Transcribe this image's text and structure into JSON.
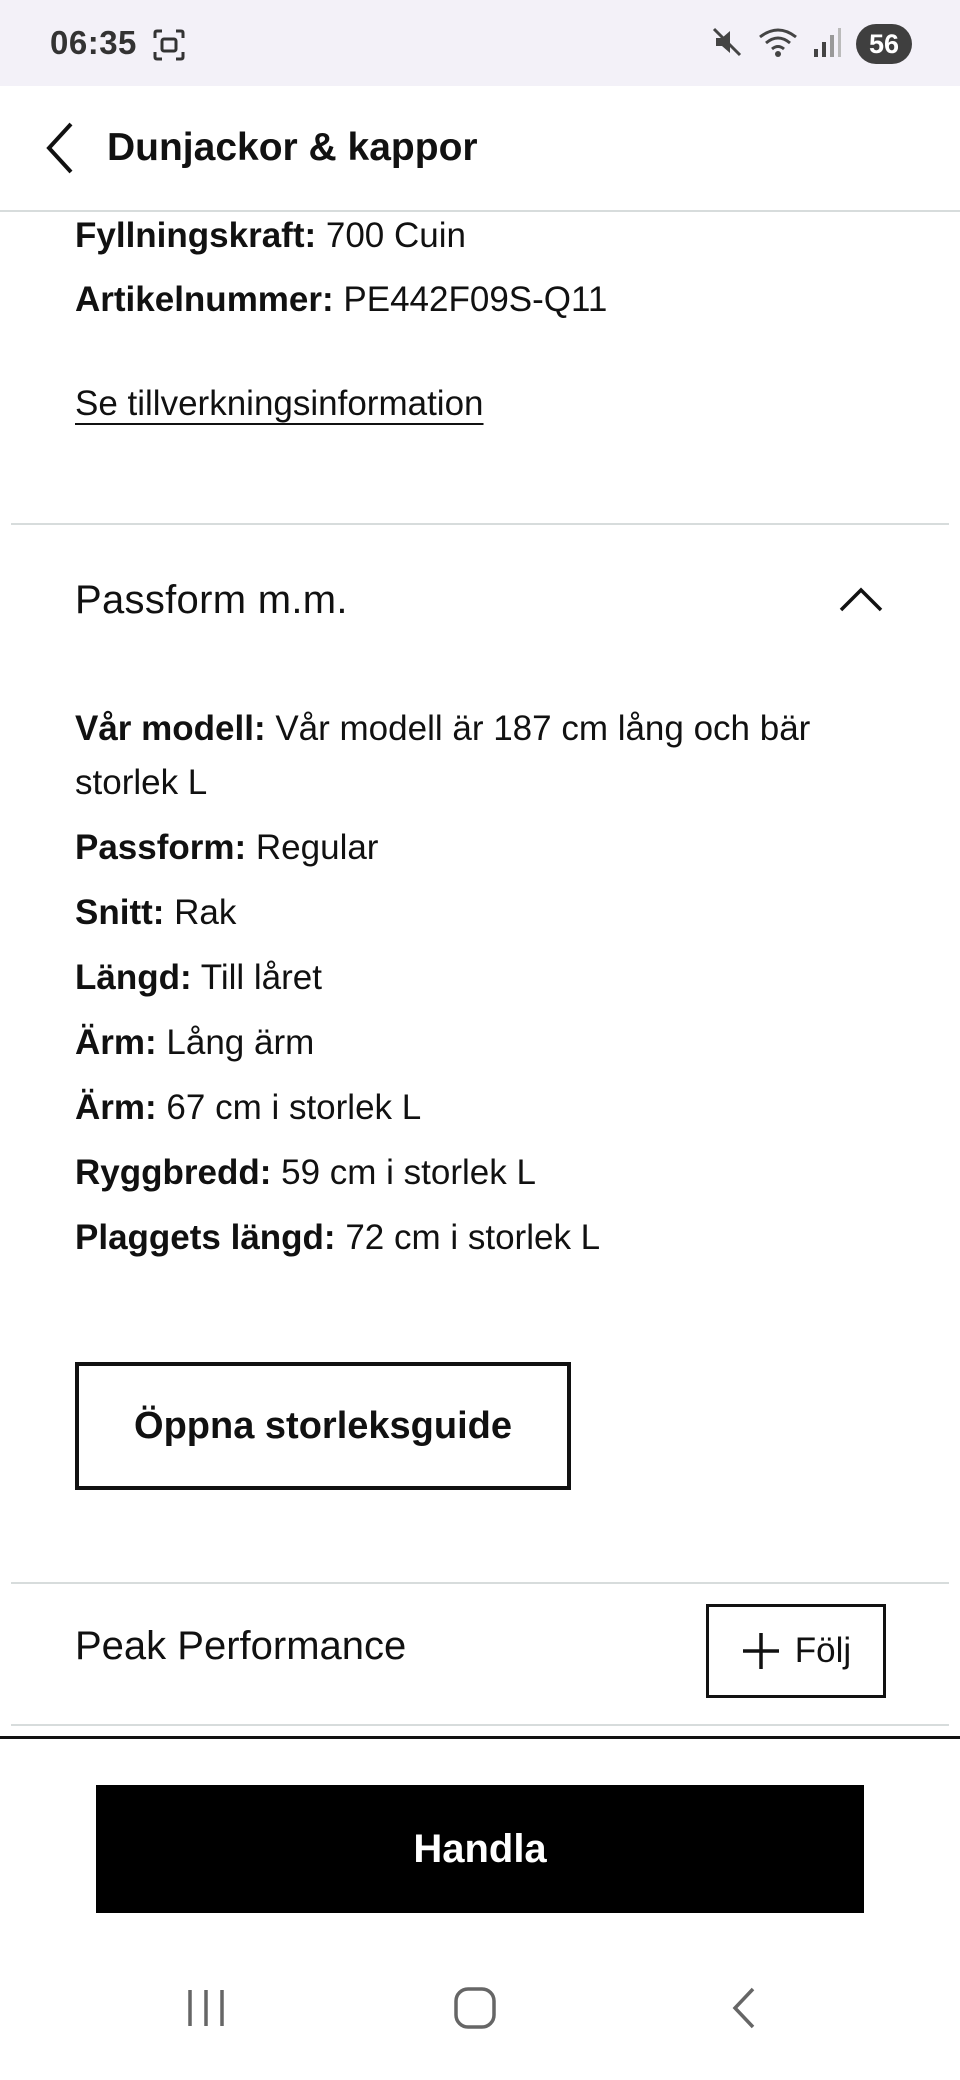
{
  "status_bar": {
    "time": "06:35",
    "battery": "56",
    "icons": [
      "screenshot-icon",
      "mute-icon",
      "wifi-icon",
      "signal-icon"
    ]
  },
  "header": {
    "title": "Dunjackor & kappor",
    "back_icon": "chevron-left-icon"
  },
  "details": {
    "fill_power_label": "Fyllningskraft:",
    "fill_power_value": " 700 Cuin",
    "article_number_label": "Artikelnummer:",
    "article_number_value": " PE442F09S-Q11",
    "manufacturing_link": "Se tillverkningsinformation"
  },
  "fit_section": {
    "title": "Passform m.m.",
    "expanded_icon": "chevron-up-icon",
    "rows": [
      {
        "label": "Vår modell:",
        "value": " Vår modell är 187 cm lång och bär storlek L"
      },
      {
        "label": "Passform:",
        "value": " Regular"
      },
      {
        "label": "Snitt:",
        "value": " Rak"
      },
      {
        "label": "Längd:",
        "value": " Till låret"
      },
      {
        "label": "Ärm:",
        "value": " Lång ärm"
      },
      {
        "label": "Ärm:",
        "value": " 67 cm i storlek L"
      },
      {
        "label": "Ryggbredd:",
        "value": " 59 cm i storlek L"
      },
      {
        "label": "Plaggets längd:",
        "value": " 72 cm i storlek L"
      }
    ],
    "size_guide_button": "Öppna storleksguide"
  },
  "brand": {
    "name": "Peak Performance",
    "follow_label": "Följ",
    "follow_icon": "plus-icon"
  },
  "cta": {
    "buy_label": "Handla"
  },
  "nav": {
    "recents_icon": "recents-icon",
    "home_icon": "home-icon",
    "back_icon": "back-icon"
  },
  "colors": {
    "status_bar_bg": "#f3f1f8",
    "divider": "#d7dcdc",
    "text": "#111111",
    "cta_bg": "#000000",
    "cta_text": "#ffffff"
  }
}
